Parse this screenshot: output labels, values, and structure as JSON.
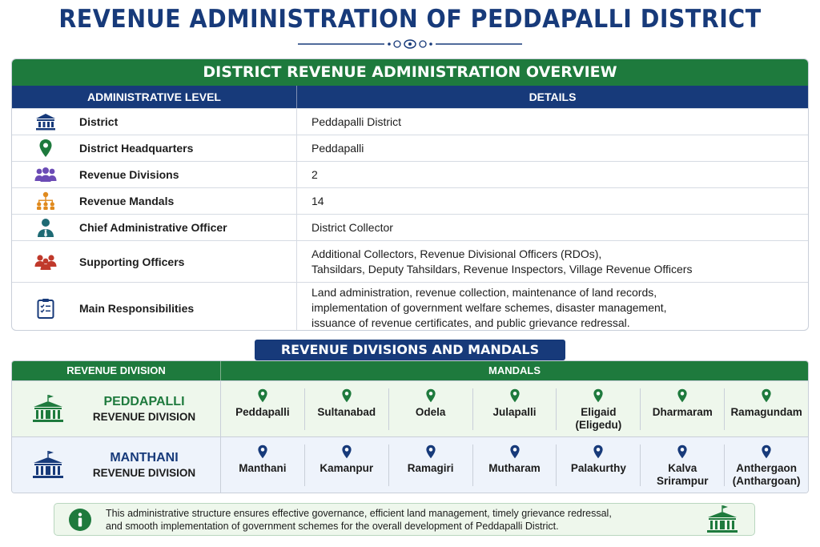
{
  "title": "REVENUE ADMINISTRATION OF PEDDAPALLI DISTRICT",
  "overview": {
    "heading": "DISTRICT REVENUE ADMINISTRATION OVERVIEW",
    "col_level": "ADMINISTRATIVE LEVEL",
    "col_details": "DETAILS",
    "rows": [
      {
        "icon": "building-icon",
        "label": "District",
        "details": [
          "Peddapalli District"
        ]
      },
      {
        "icon": "location-pin-icon",
        "label": "District Headquarters",
        "details": [
          "Peddapalli"
        ]
      },
      {
        "icon": "people-group-icon",
        "label": "Revenue Divisions",
        "details": [
          "2"
        ]
      },
      {
        "icon": "hierarchy-icon",
        "label": "Revenue Mandals",
        "details": [
          "14"
        ]
      },
      {
        "icon": "officer-icon",
        "label": "Chief Administrative Officer",
        "details": [
          "District Collector"
        ]
      },
      {
        "icon": "team-icon",
        "label": "Supporting Officers",
        "details": [
          "Additional Collectors, Revenue Divisional Officers (RDOs),",
          "Tahsildars, Deputy Tahsildars, Revenue Inspectors, Village Revenue Officers"
        ]
      },
      {
        "icon": "clipboard-icon",
        "label": "Main Responsibilities",
        "details": [
          "Land administration, revenue collection, maintenance of land records,",
          "implementation of government welfare schemes, disaster management,",
          "issuance of revenue certificates, and public grievance redressal."
        ]
      }
    ]
  },
  "divisions": {
    "banner": "REVENUE DIVISIONS AND MANDALS",
    "col_division": "REVENUE DIVISION",
    "col_mandals": "MANDALS",
    "rows": [
      {
        "name": "PEDDAPALLI",
        "sub": "REVENUE DIVISION",
        "color": "#1e7a3d",
        "mandals": [
          [
            "Peddapalli"
          ],
          [
            "Sultanabad"
          ],
          [
            "Odela"
          ],
          [
            "Julapalli"
          ],
          [
            "Eligaid",
            "(Eligedu)"
          ],
          [
            "Dharmaram"
          ],
          [
            "Ramagundam"
          ]
        ]
      },
      {
        "name": "MANTHANI",
        "sub": "REVENUE DIVISION",
        "color": "#173a7a",
        "mandals": [
          [
            "Manthani"
          ],
          [
            "Kamanpur"
          ],
          [
            "Ramagiri"
          ],
          [
            "Mutharam"
          ],
          [
            "Palakurthy"
          ],
          [
            "Kalva",
            "Srirampur"
          ],
          [
            "Anthergaon",
            "(Anthargoan)"
          ]
        ]
      }
    ]
  },
  "note": {
    "lines": [
      "This administrative structure ensures effective governance, efficient land management, timely grievance redressal,",
      "and smooth implementation of government schemes for the overall development of Peddapalli District."
    ]
  },
  "colors": {
    "green": "#1e7a3d",
    "navy": "#173a7a",
    "purple": "#6b4bb5",
    "orange": "#e08a1e",
    "red": "#c0392b"
  }
}
